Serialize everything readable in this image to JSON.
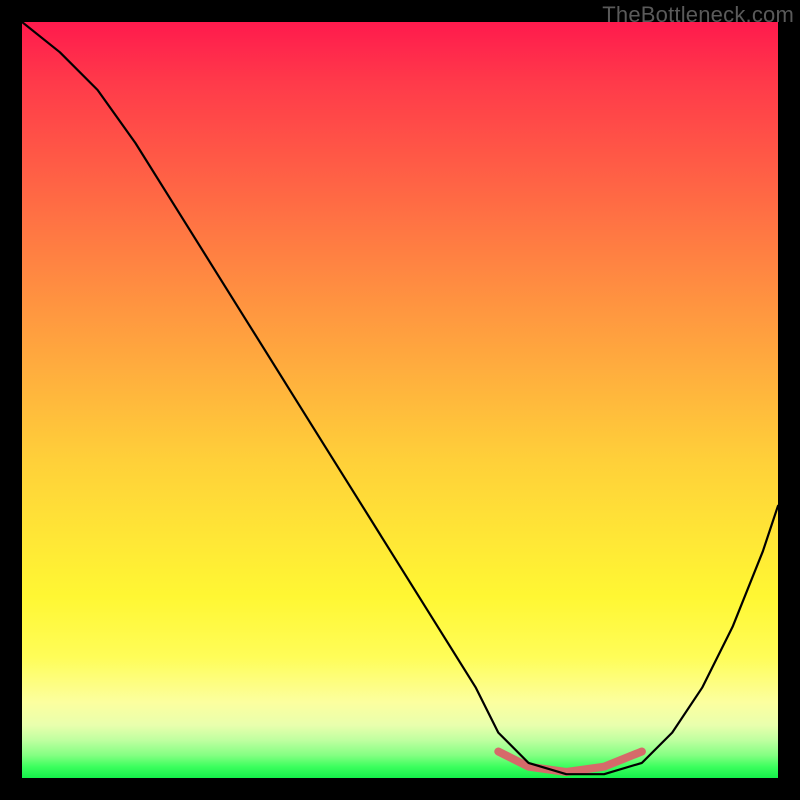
{
  "watermark": {
    "text": "TheBottleneck.com"
  },
  "chart_data": {
    "type": "line",
    "title": "",
    "xlabel": "",
    "ylabel": "",
    "xlim": [
      0,
      100
    ],
    "ylim": [
      0,
      100
    ],
    "series": [
      {
        "name": "curve",
        "x": [
          0,
          5,
          10,
          15,
          20,
          25,
          30,
          35,
          40,
          45,
          50,
          55,
          60,
          63,
          67,
          72,
          77,
          82,
          86,
          90,
          94,
          98,
          100
        ],
        "y": [
          100,
          96,
          91,
          84,
          76,
          68,
          60,
          52,
          44,
          36,
          28,
          20,
          12,
          6,
          2,
          0.5,
          0.5,
          2,
          6,
          12,
          20,
          30,
          36
        ]
      }
    ],
    "accent_segment": {
      "name": "green-zone-marker",
      "x": [
        63,
        67,
        72,
        77,
        82
      ],
      "y": [
        3.5,
        1.5,
        0.8,
        1.5,
        3.5
      ]
    },
    "background": {
      "gradient_top": "#ff1a4d",
      "gradient_bottom": "#14f04a"
    }
  }
}
